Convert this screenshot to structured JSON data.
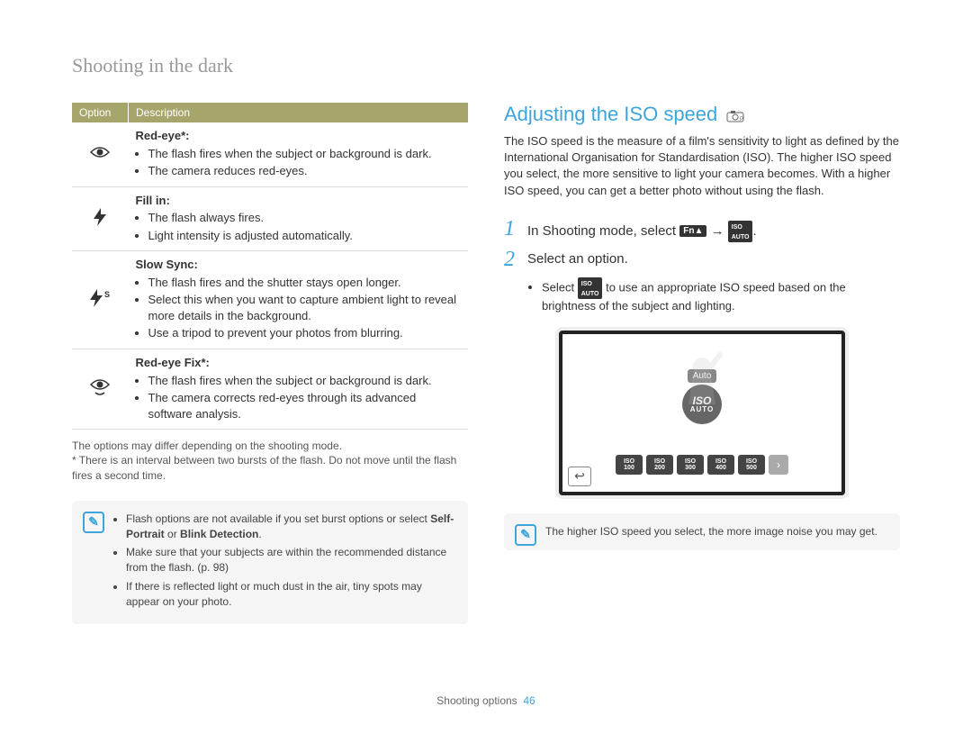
{
  "breadcrumb": "Shooting in the dark",
  "table_header": {
    "option": "Option",
    "description": "Description"
  },
  "options": [
    {
      "icon": "redeye-icon",
      "title": "Red-eye*:",
      "bullets": [
        "The flash fires when the subject or background is dark.",
        "The camera reduces red-eyes."
      ]
    },
    {
      "icon": "fillin-icon",
      "title": "Fill in:",
      "bullets": [
        "The flash always fires.",
        "Light intensity is adjusted automatically."
      ]
    },
    {
      "icon": "slowsync-icon",
      "title": "Slow Sync:",
      "bullets": [
        "The flash fires and the shutter stays open longer.",
        "Select this when you want to capture ambient light to reveal more details in the background.",
        "Use a tripod to prevent your photos from blurring."
      ]
    },
    {
      "icon": "redeyefix-icon",
      "title": "Red-eye Fix*:",
      "bullets": [
        "The flash fires when the subject or background is dark.",
        "The camera corrects red-eyes through its advanced software analysis."
      ]
    }
  ],
  "footnotes": {
    "line1": "The options may differ depending on the shooting mode.",
    "line2": "* There is an interval between two bursts of the flash. Do not move until the flash fires a second time."
  },
  "note_left": {
    "items": [
      {
        "pre": "Flash options are not available if you set burst options or select ",
        "bold": "Self-Portrait",
        "mid": " or ",
        "bold2": "Blink Detection",
        "post": "."
      },
      {
        "text": "Make sure that your subjects are within the recommended distance from the flash. (p. 98)"
      },
      {
        "text": "If there is reflected light or much dust in the air, tiny spots may appear on your photo."
      }
    ]
  },
  "right": {
    "title": "Adjusting the ISO speed",
    "mode_icon": "camera-p-icon",
    "paragraph": "The ISO speed is the measure of a film's sensitivity to light as defined by the International Organisation for Standardisation (ISO). The higher ISO speed you select, the more sensitive to light your camera becomes. With a higher ISO speed, you can get a better photo without using the flash.",
    "step1": "In Shooting mode, select",
    "step1_key1": "Fn▲",
    "step1_arrow": "→",
    "step1_key2": "ISO AUTO",
    "step2": "Select an option.",
    "substep_pre": "Select ",
    "substep_key": "ISO AUTO",
    "substep_post": " to use an appropriate ISO speed based on the brightness of the subject and lighting.",
    "screenshot": {
      "auto_label": "Auto",
      "badge_top": "ISO",
      "badge_bot": "AUTO",
      "chips": [
        "100",
        "200",
        "300",
        "400",
        "500"
      ]
    },
    "note": "The higher ISO speed you select, the more image noise you may get."
  },
  "footer": {
    "section": "Shooting options",
    "page": "46"
  }
}
